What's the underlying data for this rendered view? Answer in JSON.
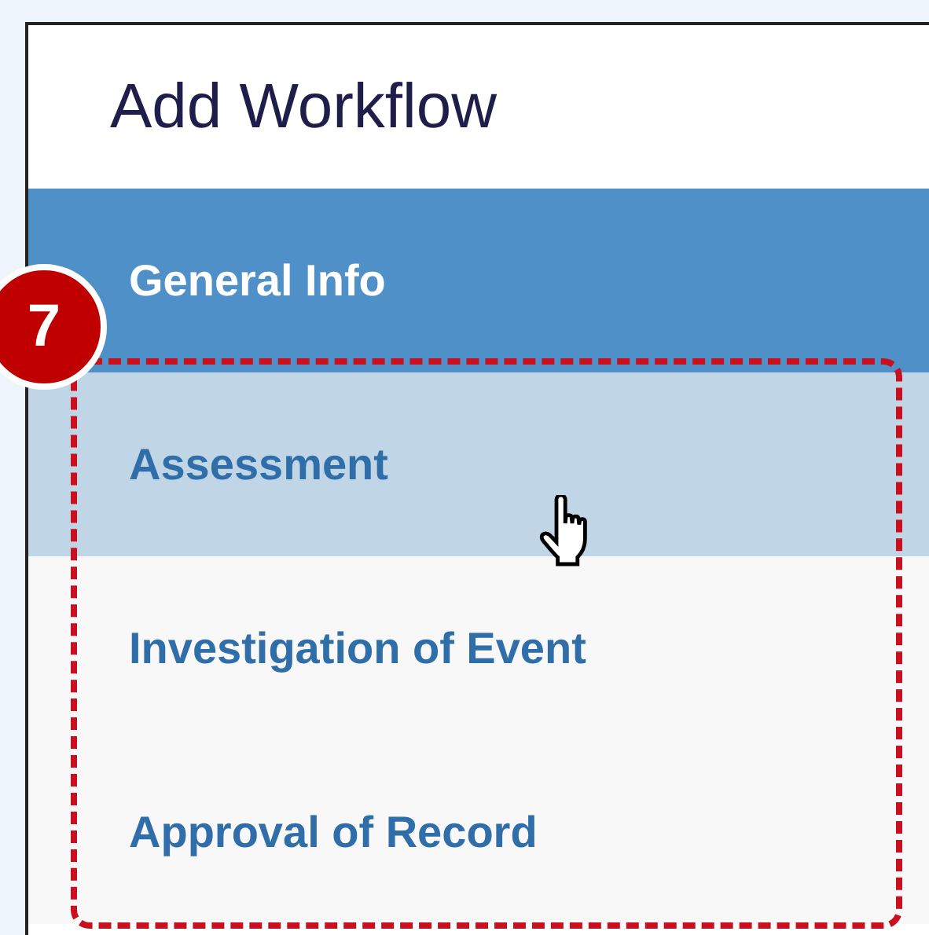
{
  "panel": {
    "title": "Add Workflow"
  },
  "steps": [
    {
      "label": "General Info",
      "selected": true,
      "hovered": false
    },
    {
      "label": "Assessment",
      "selected": false,
      "hovered": true
    },
    {
      "label": "Investigation of Event",
      "selected": false,
      "hovered": false
    },
    {
      "label": "Approval of Record",
      "selected": false,
      "hovered": false
    }
  ],
  "callout": {
    "number": "7"
  }
}
